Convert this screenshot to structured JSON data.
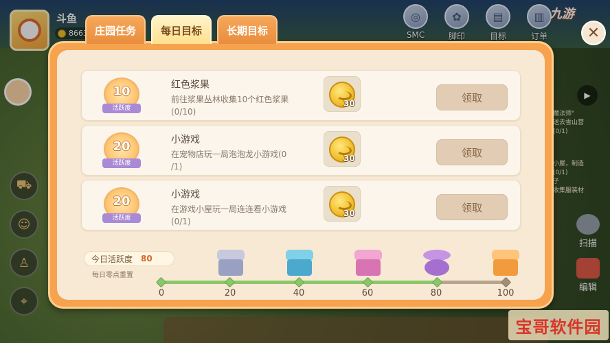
{
  "player": {
    "name": "斗鱼",
    "coins": "8663"
  },
  "top_icons": [
    {
      "name": "smc-icon",
      "label": "SMC"
    },
    {
      "name": "footprint-icon",
      "label": "脚印"
    },
    {
      "name": "target-icon",
      "label": "目标"
    },
    {
      "name": "order-icon",
      "label": "订单"
    }
  ],
  "brand": "九游",
  "tabs": [
    {
      "label": "庄园任务",
      "active": false
    },
    {
      "label": "每日目标",
      "active": true
    },
    {
      "label": "长期目标",
      "active": false
    }
  ],
  "tasks": [
    {
      "points": "10",
      "badge_label": "活跃度",
      "title": "红色浆果",
      "desc": "前往浆果丛林收集10个红色浆果",
      "progress": "(0/10)",
      "reward_qty": "30",
      "button": "领取"
    },
    {
      "points": "20",
      "badge_label": "活跃度",
      "title": "小游戏",
      "desc": "在宠物店玩一局泡泡龙小游戏(0",
      "progress": "/1)",
      "reward_qty": "30",
      "button": "领取"
    },
    {
      "points": "20",
      "badge_label": "活跃度",
      "title": "小游戏",
      "desc": "在游戏小屋玩一局连连看小游戏",
      "progress": "(0/1)",
      "reward_qty": "30",
      "button": "领取"
    }
  ],
  "activity": {
    "label": "今日活跃度",
    "value": "80",
    "reset_note": "每日零点重置",
    "progress_fraction": 0.8
  },
  "milestones": [
    "0",
    "20",
    "40",
    "60",
    "80",
    "100"
  ],
  "right_side": {
    "scan": "扫描",
    "edit": "编辑",
    "quest_lines": [
      "魔法师\"",
      "送去雪山营",
      "(0/1)",
      "小屋，制造",
      "(0/1)",
      "子",
      "收集服装材"
    ]
  },
  "watermark": "宝哥软件园"
}
